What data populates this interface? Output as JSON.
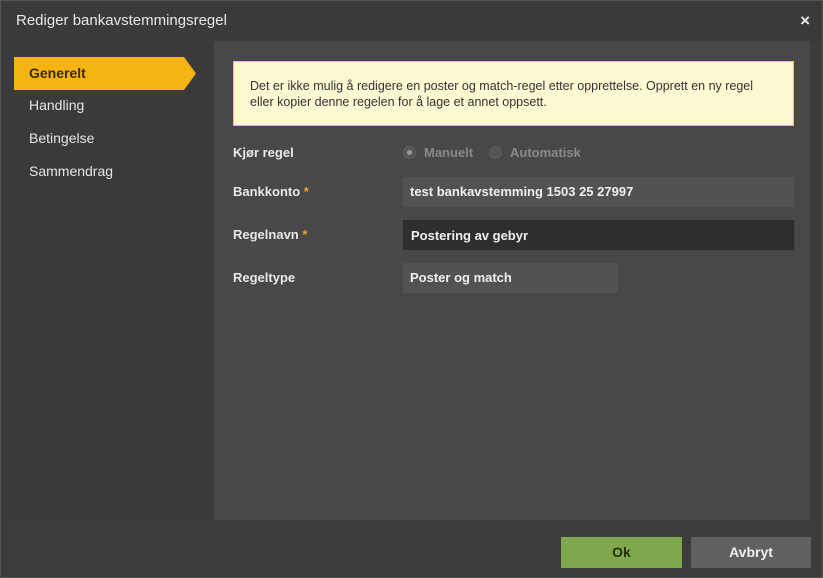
{
  "dialog": {
    "title": "Rediger bankavstemmingsregel",
    "close_icon": "×"
  },
  "sidebar": {
    "items": [
      {
        "label": "Generelt",
        "active": true
      },
      {
        "label": "Handling",
        "active": false
      },
      {
        "label": "Betingelse",
        "active": false
      },
      {
        "label": "Sammendrag",
        "active": false
      }
    ]
  },
  "notice": {
    "text": "Det er ikke mulig å redigere en poster og match-regel etter opprettelse. Opprett en ny regel eller kopier denne regelen for å lage et annet oppsett."
  },
  "form": {
    "run_rule": {
      "label": "Kjør regel",
      "options": [
        {
          "label": "Manuelt",
          "selected": true
        },
        {
          "label": "Automatisk",
          "selected": false
        }
      ]
    },
    "bank_account": {
      "label": "Bankkonto",
      "required_mark": "*",
      "value": "test bankavstemming 1503 25 27997"
    },
    "rule_name": {
      "label": "Regelnavn",
      "required_mark": "*",
      "value": "Postering av gebyr"
    },
    "rule_type": {
      "label": "Regeltype",
      "value": "Poster og match"
    }
  },
  "footer": {
    "ok_label": "Ok",
    "cancel_label": "Avbryt"
  },
  "colors": {
    "accent": "#f6b414",
    "ok": "#7ea84b",
    "required": "#f0a030",
    "notice_bg": "#fdf9d3"
  }
}
